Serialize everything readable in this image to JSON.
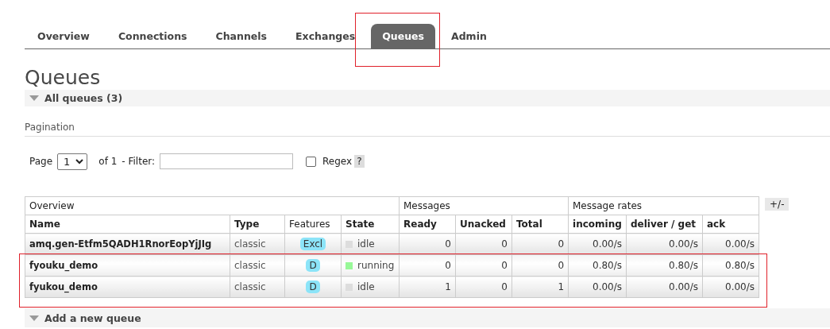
{
  "tabs": [
    {
      "label": "Overview",
      "selected": false
    },
    {
      "label": "Connections",
      "selected": false
    },
    {
      "label": "Channels",
      "selected": false
    },
    {
      "label": "Exchanges",
      "selected": false
    },
    {
      "label": "Queues",
      "selected": true
    },
    {
      "label": "Admin",
      "selected": false
    }
  ],
  "page_title": "Queues",
  "all_queues": {
    "label": "All queues (3)"
  },
  "pagination": {
    "title": "Pagination",
    "page_label": "Page",
    "page_value": "1",
    "of_label": "of 1",
    "filter_label": "- Filter:",
    "regex_label": "Regex",
    "regex_checked": false,
    "help": "?"
  },
  "table": {
    "groups": [
      {
        "label": "Overview"
      },
      {
        "label": "Messages"
      },
      {
        "label": "Message rates"
      }
    ],
    "columns": [
      "Name",
      "Type",
      "Features",
      "State",
      "Ready",
      "Unacked",
      "Total",
      "incoming",
      "deliver / get",
      "ack"
    ],
    "toggle": "+/-",
    "rows": [
      {
        "name": "amq.gen-Etfm5QADH1RnorEopYjJIg",
        "type": "classic",
        "feature": "Excl",
        "state": "idle",
        "color": "#dddddd",
        "ready": "0",
        "unacked": "0",
        "total": "0",
        "incoming": "0.00/s",
        "deliver": "0.00/s",
        "ack": "0.00/s"
      },
      {
        "name": "fyouku_demo",
        "type": "classic",
        "feature": "D",
        "state": "running",
        "color": "#98f898",
        "ready": "0",
        "unacked": "0",
        "total": "0",
        "incoming": "0.80/s",
        "deliver": "0.80/s",
        "ack": "0.80/s"
      },
      {
        "name": "fyukou_demo",
        "type": "classic",
        "feature": "D",
        "state": "idle",
        "color": "#dddddd",
        "ready": "1",
        "unacked": "0",
        "total": "1",
        "incoming": "0.00/s",
        "deliver": "0.00/s",
        "ack": "0.00/s"
      }
    ]
  },
  "add_queue": {
    "label": "Add a new queue"
  }
}
